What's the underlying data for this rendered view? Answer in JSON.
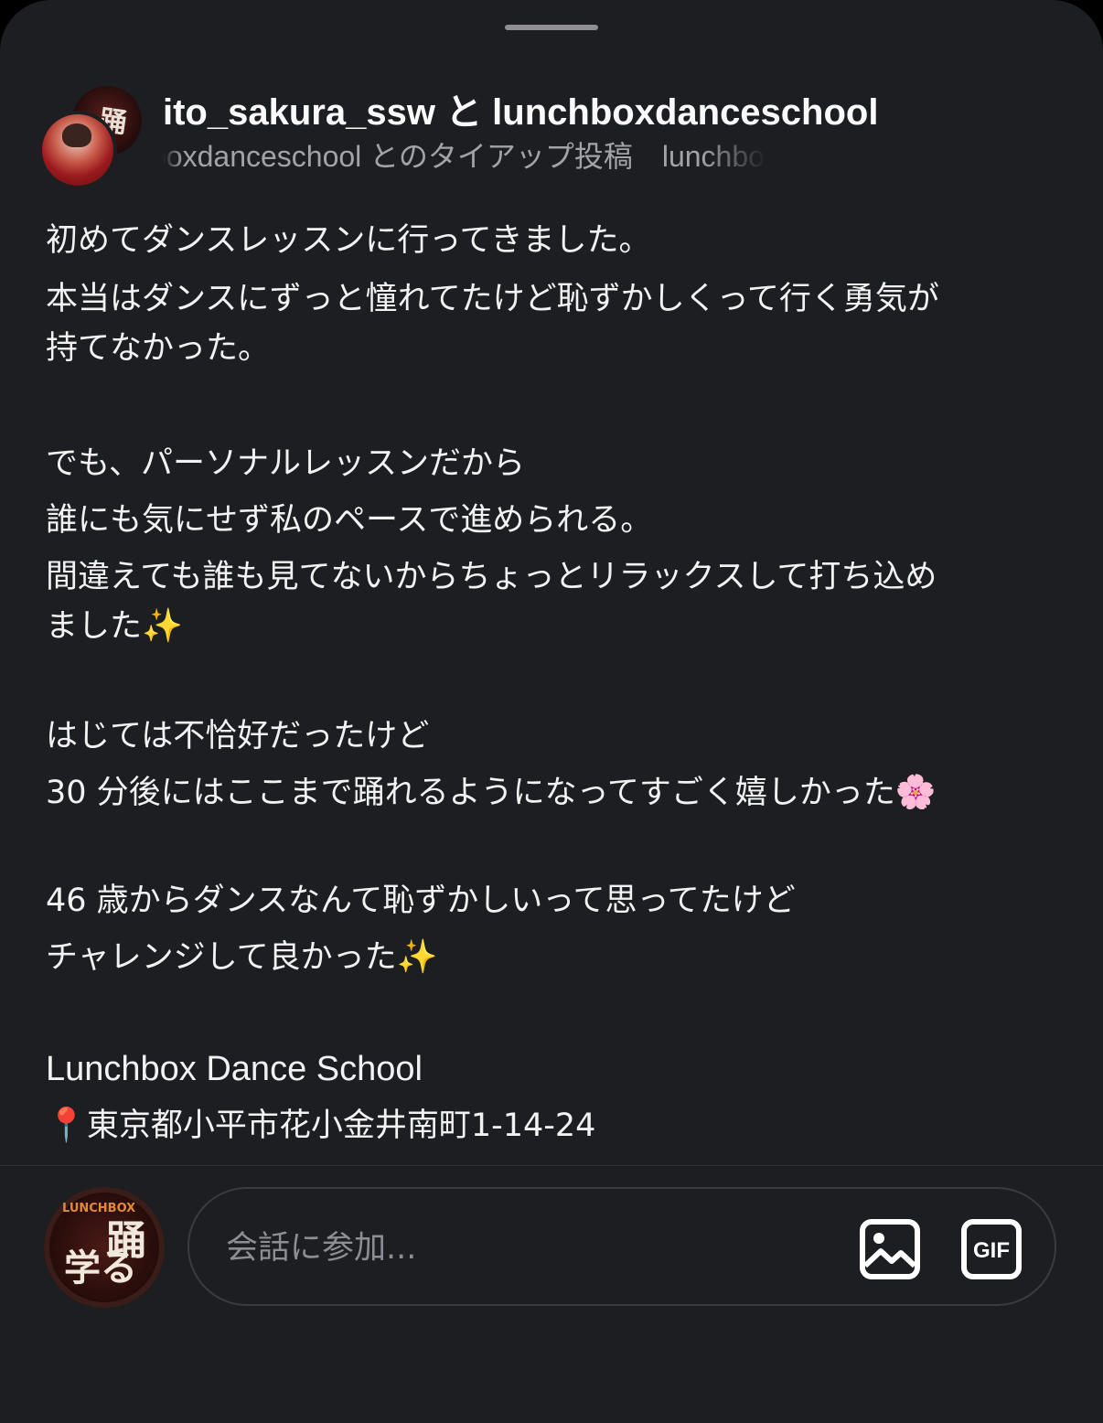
{
  "header": {
    "title": "ito_sakura_ssw と lunchboxdanceschool",
    "subtitle": "boxdanceschool とのタイアップ投稿　lunchboxdanceschool"
  },
  "icons": {
    "image_icon": "image-icon",
    "gif_icon": "gif-icon"
  },
  "post": {
    "lines": [
      "初めてダンスレッスンに行ってきました。",
      "本当はダンスにずっと憧れてたけど恥ずかしくって行く勇気が",
      "持てなかった。",
      "でも、パーソナルレッスンだから",
      "誰にも気にせず私のペースで進められる。",
      "間違えても誰も見てないからちょっとリラックスして打ち込め",
      "ました",
      "はじては不恰好だったけど",
      "30 分後にはここまで踊れるようになってすごく嬉しかった",
      "46 歳からダンスなんて恥ずかしいって思ってたけど",
      "チャレンジして良かった",
      "Lunchbox Dance School",
      "東京都小平市花小金井南町1-14-24"
    ],
    "emoji": {
      "sparkles": "✨",
      "blossom": "🌸",
      "pin": "📍"
    }
  },
  "composer": {
    "placeholder": "会話に参加...",
    "gif_label": "GIF"
  }
}
